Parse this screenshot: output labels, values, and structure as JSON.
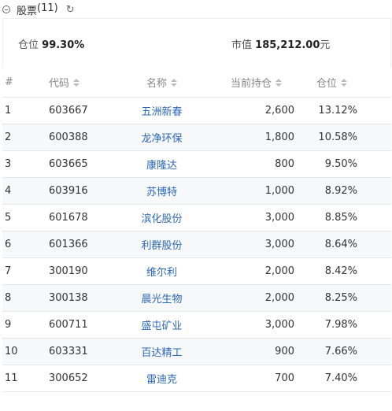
{
  "header": {
    "title": "股票",
    "count": "(11)"
  },
  "summary": {
    "position_label": "仓位",
    "position_value": "99.30%",
    "market_value_label": "市值",
    "market_value": "185,212.00",
    "market_value_unit": "元"
  },
  "table": {
    "columns": {
      "index": "#",
      "code": "代码",
      "name": "名称",
      "qty": "当前持仓",
      "position": "仓位"
    },
    "rows": [
      {
        "index": "1",
        "code": "603667",
        "name": "五洲新春",
        "qty": "2,600",
        "position": "13.12%"
      },
      {
        "index": "2",
        "code": "600388",
        "name": "龙净环保",
        "qty": "1,800",
        "position": "10.58%"
      },
      {
        "index": "3",
        "code": "603665",
        "name": "康隆达",
        "qty": "800",
        "position": "9.50%"
      },
      {
        "index": "4",
        "code": "603916",
        "name": "苏博特",
        "qty": "1,000",
        "position": "8.92%"
      },
      {
        "index": "5",
        "code": "601678",
        "name": "滨化股份",
        "qty": "3,000",
        "position": "8.85%"
      },
      {
        "index": "6",
        "code": "601366",
        "name": "利群股份",
        "qty": "3,000",
        "position": "8.64%"
      },
      {
        "index": "7",
        "code": "300190",
        "name": "维尔利",
        "qty": "2,000",
        "position": "8.42%"
      },
      {
        "index": "8",
        "code": "300138",
        "name": "晨光生物",
        "qty": "2,000",
        "position": "8.25%"
      },
      {
        "index": "9",
        "code": "600711",
        "name": "盛屯矿业",
        "qty": "3,000",
        "position": "7.98%"
      },
      {
        "index": "10",
        "code": "603331",
        "name": "百达精工",
        "qty": "900",
        "position": "7.66%"
      },
      {
        "index": "11",
        "code": "300652",
        "name": "雷迪克",
        "qty": "700",
        "position": "7.40%"
      }
    ]
  }
}
